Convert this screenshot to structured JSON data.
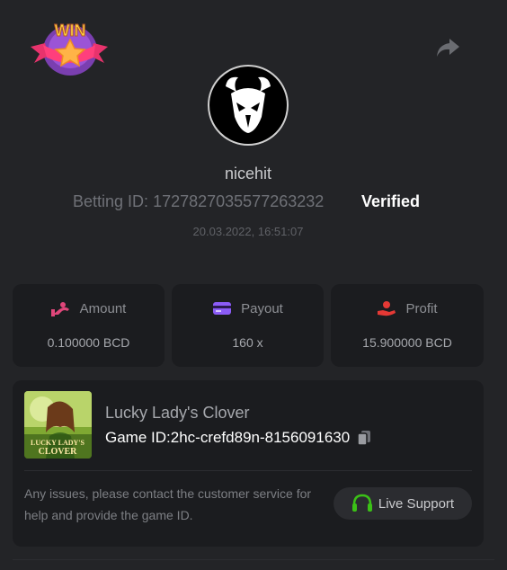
{
  "badge": {
    "text": "WIN"
  },
  "player": {
    "username": "nicehit",
    "betting_id_label": "Betting ID:",
    "betting_id": "1727827035577263232",
    "verified": "Verified",
    "timestamp": "20.03.2022, 16:51:07"
  },
  "stats": [
    {
      "label": "Amount",
      "value": "0.100000 BCD",
      "icon": "amount-icon",
      "color": "#e0467a"
    },
    {
      "label": "Payout",
      "value": "160 x",
      "icon": "card-icon",
      "color": "#8b5cf6"
    },
    {
      "label": "Profit",
      "value": "15.900000 BCD",
      "icon": "profit-icon",
      "color": "#e53935"
    }
  ],
  "game": {
    "title": "Lucky Lady's Clover",
    "id_label": "Game ID:",
    "id": "2hc-crefd89n-8156091630",
    "thumb_text_1": "LUCKY LADY'S",
    "thumb_text_2": "CLOVER"
  },
  "support": {
    "text": "Any issues, please contact the customer service for help and provide the game ID.",
    "button_label": "Live Support",
    "icon_color": "#3bc117"
  }
}
